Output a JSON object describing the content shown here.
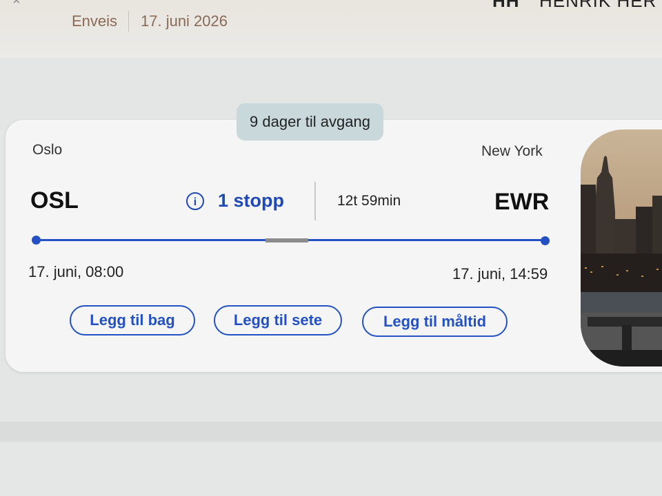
{
  "header": {
    "close_icon": "×",
    "trip_type": "Enveis",
    "date": "17. juni 2026",
    "passenger_initials": "HH",
    "passenger_name": "HENRIK HER"
  },
  "flight": {
    "countdown": "9 dager til avgang",
    "origin_city": "Oslo",
    "destination_city": "New York",
    "origin_code": "OSL",
    "destination_code": "EWR",
    "info_icon_glyph": "i",
    "stops_label": "1 stopp",
    "duration": "12t 59min",
    "departure": "17. juni, 08:00",
    "arrival": "17. juni, 14:59"
  },
  "actions": {
    "add_bag": "Legg til bag",
    "add_seat": "Legg til sete",
    "add_meal": "Legg til måltid"
  },
  "colors": {
    "accent": "#2351c4",
    "countdown_bg": "#c9d9db",
    "header_text": "#8a6a55"
  },
  "icons": {
    "stops": "info-icon",
    "close": "close-icon"
  }
}
